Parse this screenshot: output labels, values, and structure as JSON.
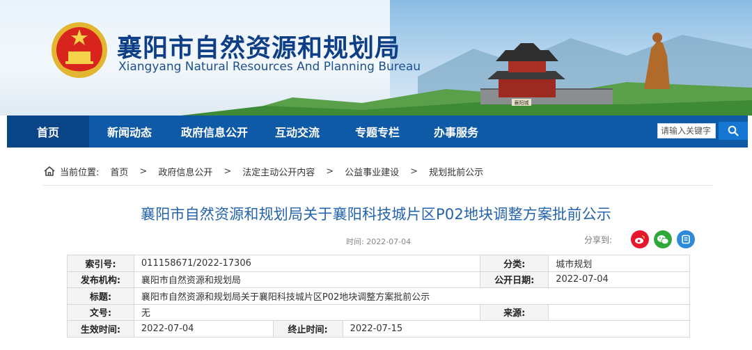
{
  "header": {
    "title": "襄阳市自然资源和规划局",
    "subtitle": "Xiangyang Natural Resources And Planning Bureau",
    "gate_plaque": "襄阳城"
  },
  "nav": {
    "items": [
      {
        "label": "首页",
        "active": true
      },
      {
        "label": "新闻动态"
      },
      {
        "label": "政府信息公开"
      },
      {
        "label": "互动交流"
      },
      {
        "label": "专题专栏"
      },
      {
        "label": "办事服务"
      }
    ],
    "search_placeholder": "请输入关键字"
  },
  "breadcrumb": {
    "prefix": "当前位置:",
    "items": [
      "首页",
      "政府信息公开",
      "法定主动公开内容",
      "公益事业建设",
      "规划批前公示"
    ],
    "separator": ">"
  },
  "article": {
    "title": "襄阳市自然资源和规划局关于襄阳科技城片区P02地块调整方案批前公示",
    "time_label": "时间:",
    "time": "2022-07-04",
    "share_label": "分享到:"
  },
  "info": {
    "index_label": "索引号:",
    "index_value": "011158671/2022-17306",
    "category_label": "分类:",
    "category_value": "城市规划",
    "publisher_label": "发布机构:",
    "publisher_value": "襄阳市自然资源和规划局",
    "publish_date_label": "公开日期:",
    "publish_date_value": "2022-07-04",
    "subject_label": "标题:",
    "subject_value": "襄阳市自然资源和规划局关于襄阳科技城片区P02地块调整方案批前公示",
    "doc_no_label": "文号:",
    "doc_no_value": "无",
    "source_label": "来源:",
    "source_value": "",
    "effective_label": "生效时间:",
    "effective_value": "2022-07-04",
    "end_label": "终止时间:",
    "end_value": "2022-07-15"
  },
  "colors": {
    "nav_bg": "#0e5aa7",
    "nav_active_bg": "#0a4588",
    "title_blue": "#2463ad",
    "site_title": "#0e3f86"
  }
}
